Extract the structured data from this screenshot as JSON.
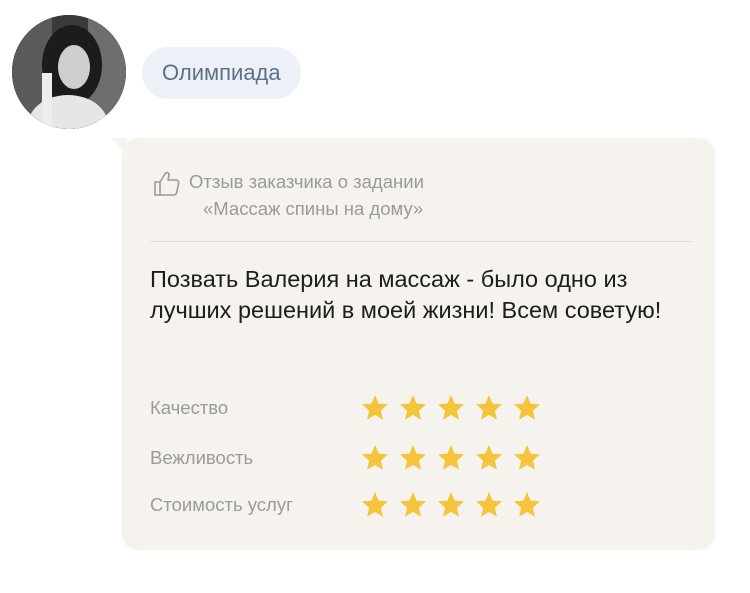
{
  "user": {
    "name": "Олимпиада"
  },
  "review": {
    "header_line1": "Отзыв заказчика о задании",
    "header_line2": "«Массаж спины на дому»",
    "text": "Позвать Валерия на массаж - было одно из лучших решений в моей жизни! Всем советую!",
    "ratings": [
      {
        "label": "Качество",
        "stars": 5,
        "max": 5
      },
      {
        "label": "Вежливость",
        "stars": 5,
        "max": 5
      },
      {
        "label": "Стоимость услуг",
        "stars": 5,
        "max": 5
      }
    ]
  },
  "colors": {
    "star": "#f5c43a",
    "chip_bg": "#edf1f7",
    "card_bg": "#f6f3ee"
  },
  "icons": {
    "header": "thumbs-up-icon",
    "rating": "star-icon"
  }
}
